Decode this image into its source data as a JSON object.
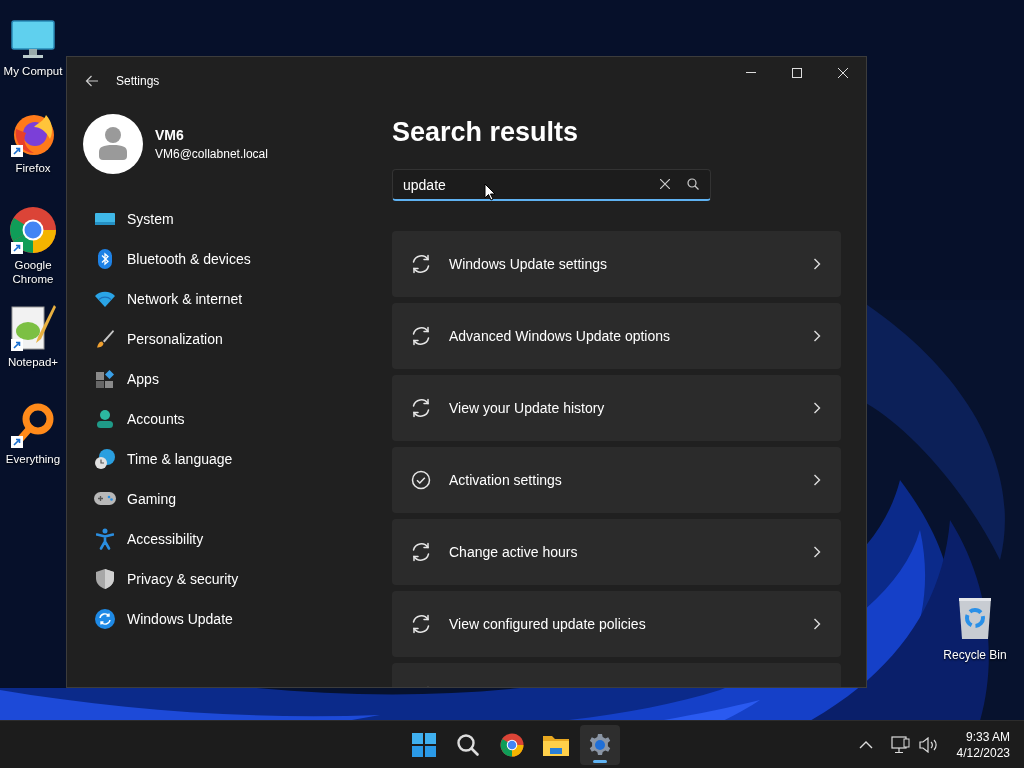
{
  "desktop_icons": [
    {
      "label": "My Comput"
    },
    {
      "label": "Firefox"
    },
    {
      "label": "Google Chrome"
    },
    {
      "label": "Notepad+"
    },
    {
      "label": "Everything"
    }
  ],
  "recycle_bin": {
    "label": "Recycle Bin"
  },
  "window": {
    "title": "Settings"
  },
  "profile": {
    "name": "VM6",
    "email": "VM6@collabnet.local"
  },
  "sidebar": {
    "items": [
      {
        "label": "System"
      },
      {
        "label": "Bluetooth & devices"
      },
      {
        "label": "Network & internet"
      },
      {
        "label": "Personalization"
      },
      {
        "label": "Apps"
      },
      {
        "label": "Accounts"
      },
      {
        "label": "Time & language"
      },
      {
        "label": "Gaming"
      },
      {
        "label": "Accessibility"
      },
      {
        "label": "Privacy & security"
      },
      {
        "label": "Windows Update"
      }
    ]
  },
  "content": {
    "heading": "Search results",
    "search": {
      "value": "update"
    },
    "results": [
      {
        "label": "Windows Update settings",
        "kind": "sync"
      },
      {
        "label": "Advanced Windows Update options",
        "kind": "sync"
      },
      {
        "label": "View your Update history",
        "kind": "sync"
      },
      {
        "label": "Activation settings",
        "kind": "check"
      },
      {
        "label": "Change active hours",
        "kind": "sync"
      },
      {
        "label": "View configured update policies",
        "kind": "sync"
      }
    ]
  },
  "taskbar": {
    "apps": [
      {
        "selected": false
      },
      {
        "selected": false
      },
      {
        "selected": false
      },
      {
        "selected": false
      },
      {
        "selected": true
      }
    ],
    "clock": {
      "time": "9:33 AM",
      "date": "4/12/2023"
    }
  }
}
